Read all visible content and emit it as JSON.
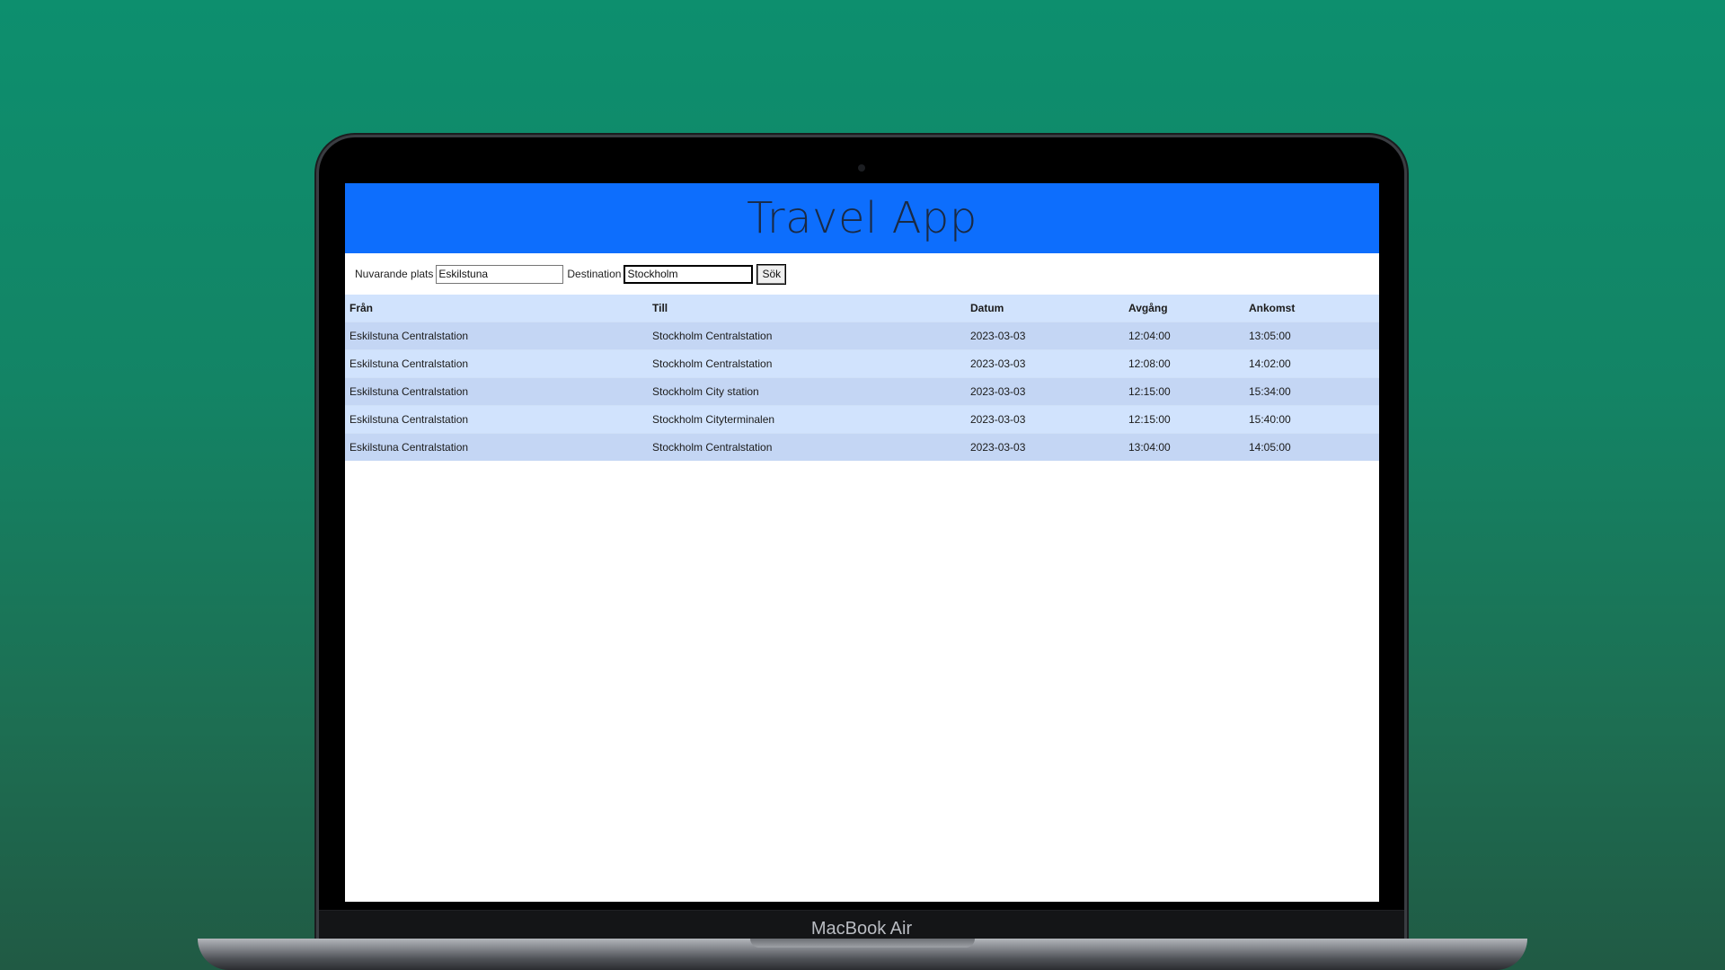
{
  "device": {
    "label": "MacBook Air"
  },
  "app": {
    "title": "Travel App"
  },
  "search": {
    "from_label": "Nuvarande plats",
    "from_value": "Eskilstuna",
    "to_label": "Destination",
    "to_value": "Stockholm",
    "button_label": "Sök"
  },
  "table": {
    "headers": [
      "Från",
      "Till",
      "Datum",
      "Avgång",
      "Ankomst"
    ],
    "rows": [
      [
        "Eskilstuna Centralstation",
        "Stockholm Centralstation",
        "2023-03-03",
        "12:04:00",
        "13:05:00"
      ],
      [
        "Eskilstuna Centralstation",
        "Stockholm Centralstation",
        "2023-03-03",
        "12:08:00",
        "14:02:00"
      ],
      [
        "Eskilstuna Centralstation",
        "Stockholm City station",
        "2023-03-03",
        "12:15:00",
        "15:34:00"
      ],
      [
        "Eskilstuna Centralstation",
        "Stockholm Cityterminalen",
        "2023-03-03",
        "12:15:00",
        "15:40:00"
      ],
      [
        "Eskilstuna Centralstation",
        "Stockholm Centralstation",
        "2023-03-03",
        "13:04:00",
        "14:05:00"
      ]
    ]
  },
  "colors": {
    "header_blue": "#0d6efd",
    "row_light": "#d1e3fd",
    "row_dark": "#c4d6f4",
    "background_green": "#0d8f6e"
  }
}
